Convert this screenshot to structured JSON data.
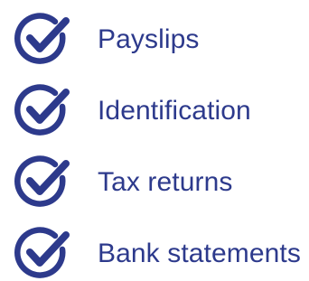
{
  "theme": {
    "accent_color": "#2d3a8c"
  },
  "checklist": {
    "items": [
      {
        "label": "Payslips",
        "icon": "check-circle-icon"
      },
      {
        "label": "Identification",
        "icon": "check-circle-icon"
      },
      {
        "label": "Tax returns",
        "icon": "check-circle-icon"
      },
      {
        "label": "Bank statements",
        "icon": "check-circle-icon"
      }
    ]
  }
}
